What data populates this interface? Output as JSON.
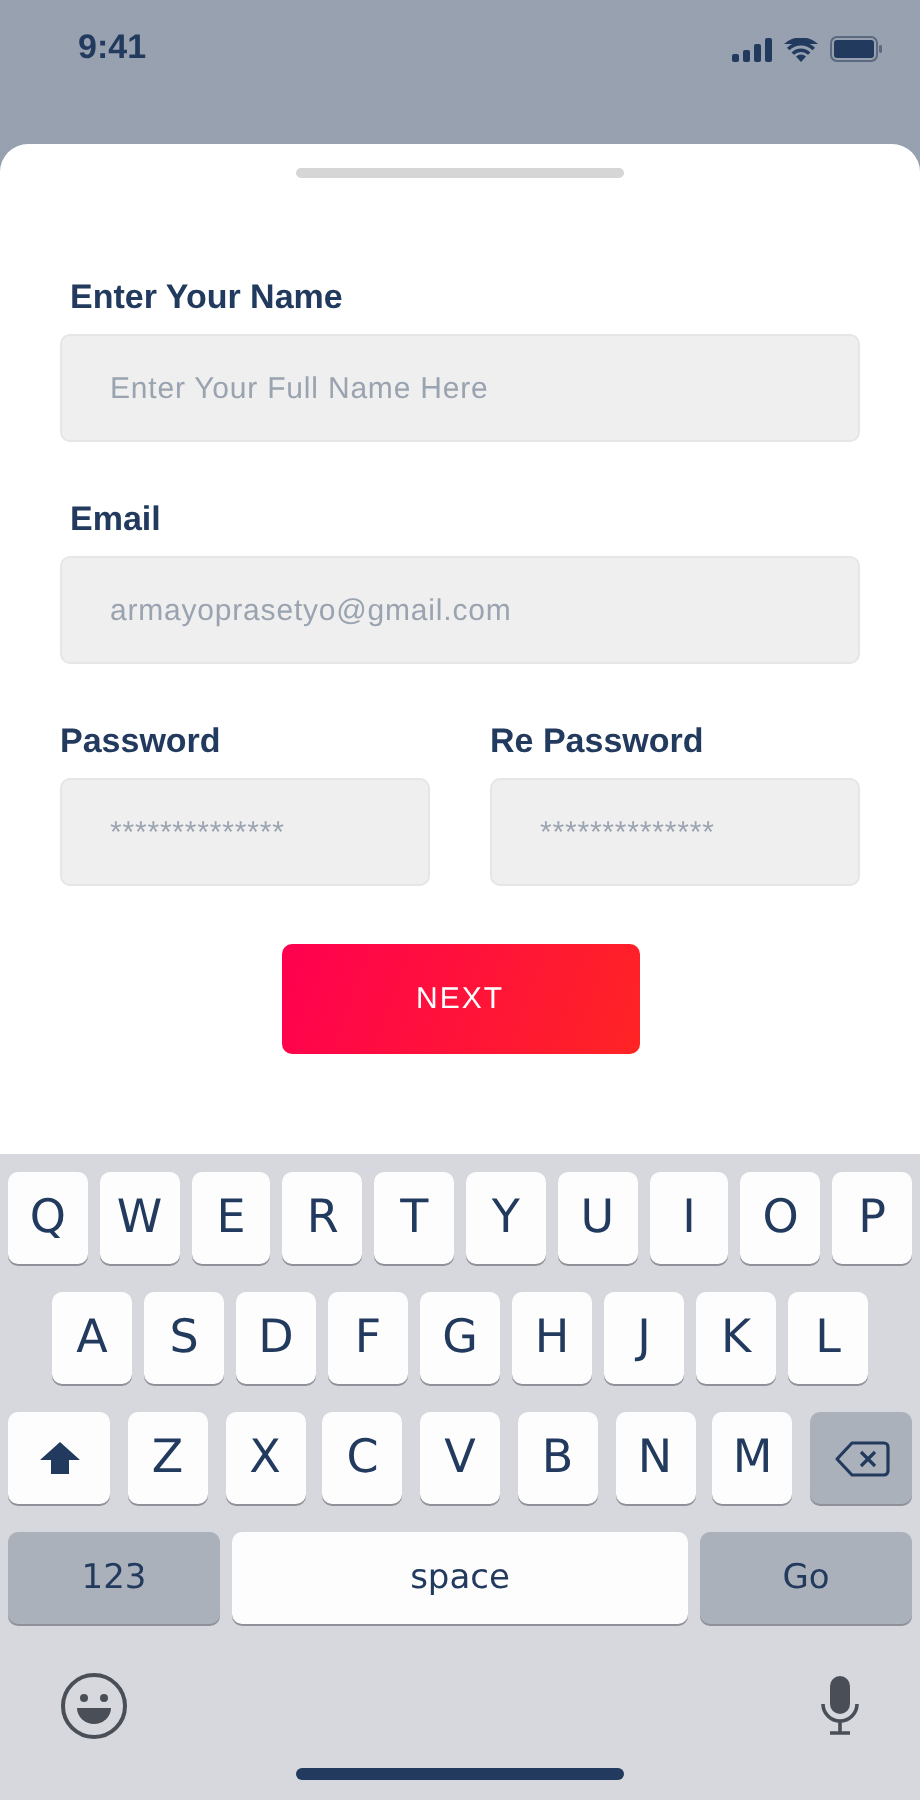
{
  "status_bar": {
    "time": "9:41"
  },
  "form": {
    "fields": [
      {
        "kind": "full",
        "label": "Enter Your Name",
        "placeholder": "Enter Your Full Name Here"
      },
      {
        "kind": "full",
        "label": "Email",
        "placeholder": "armayoprasetyo@gmail.com"
      },
      {
        "kind": "half",
        "label": "Password",
        "placeholder": "**************"
      },
      {
        "kind": "half",
        "label": "Re Password",
        "placeholder": "**************"
      }
    ],
    "button": "NEXT"
  },
  "keyboard": {
    "rows": [
      [
        {
          "kind": "letter",
          "label": "Q"
        },
        {
          "kind": "letter",
          "label": "W"
        },
        {
          "kind": "letter",
          "label": "E"
        },
        {
          "kind": "letter",
          "label": "R"
        },
        {
          "kind": "letter",
          "label": "T"
        },
        {
          "kind": "letter",
          "label": "Y"
        },
        {
          "kind": "letter",
          "label": "U"
        },
        {
          "kind": "letter",
          "label": "I"
        },
        {
          "kind": "letter",
          "label": "O"
        },
        {
          "kind": "letter",
          "label": "P"
        }
      ],
      [
        {
          "kind": "letter",
          "label": "A"
        },
        {
          "kind": "letter",
          "label": "S"
        },
        {
          "kind": "letter",
          "label": "D"
        },
        {
          "kind": "letter",
          "label": "F"
        },
        {
          "kind": "letter",
          "label": "G"
        },
        {
          "kind": "letter",
          "label": "H"
        },
        {
          "kind": "letter",
          "label": "J"
        },
        {
          "kind": "letter",
          "label": "K"
        },
        {
          "kind": "letter",
          "label": "L"
        }
      ],
      [
        {
          "kind": "shift"
        },
        {
          "kind": "letter",
          "label": "Z"
        },
        {
          "kind": "letter",
          "label": "X"
        },
        {
          "kind": "letter",
          "label": "C"
        },
        {
          "kind": "letter",
          "label": "V"
        },
        {
          "kind": "letter",
          "label": "B"
        },
        {
          "kind": "letter",
          "label": "N"
        },
        {
          "kind": "letter",
          "label": "M"
        },
        {
          "kind": "delete"
        }
      ]
    ],
    "bottom_bar": {
      "numbers_key": "123",
      "space_key": "space",
      "go_key": "Go"
    }
  }
}
